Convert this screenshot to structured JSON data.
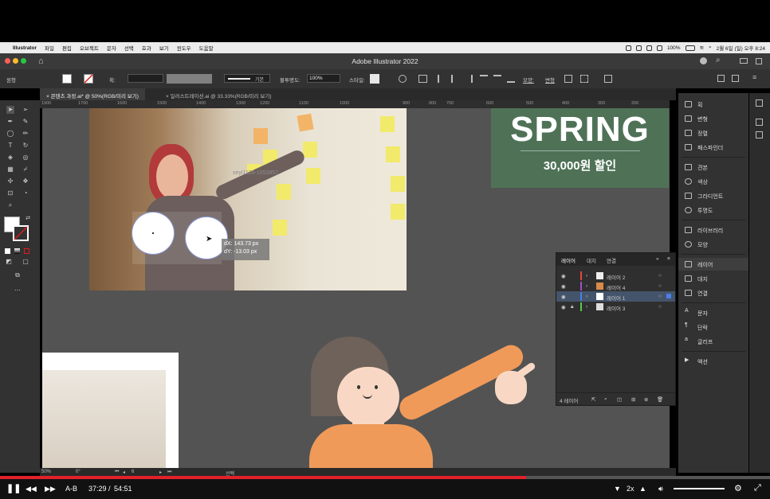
{
  "menubar": {
    "app": "Illustrator",
    "items": [
      "파일",
      "편집",
      "오브젝트",
      "문자",
      "선택",
      "효과",
      "보기",
      "윈도우",
      "도움말"
    ],
    "battery": "100%",
    "datetime": "2월 6일 (일) 오후 8:24"
  },
  "window": {
    "title": "Adobe Illustrator 2022"
  },
  "control": {
    "label": "원형",
    "stroke_label": "획:",
    "stroke_style": "기본",
    "opacity_label": "불투명도:",
    "opacity_value": "100%",
    "style_label": "스타일:",
    "shape_label": "모양:",
    "transform_label": "변형"
  },
  "tabs": [
    {
      "label": "콘텐츠 과정.ai* @ 50%(RGB/미리 보기)",
      "active": true
    },
    {
      "label": "일러스트레이션.ai @ 33.33%(RGB/미리 보기)",
      "active": false
    }
  ],
  "ruler": [
    "1900",
    "1700",
    "1600",
    "1500",
    "1400",
    "1300",
    "1200",
    "1100",
    "1000",
    "900",
    "800",
    "700",
    "600",
    "500",
    "400",
    "300",
    "200"
  ],
  "canvas": {
    "watermark": "seyi1128-1052857",
    "tooltip_dx": "dX: 143.73 px",
    "tooltip_dy": "dY: -13.03 px",
    "spring_title": "SPRING",
    "spring_sub": "30,000원 할인"
  },
  "layers_panel": {
    "tabs": [
      "레이어",
      "대지",
      "연결"
    ],
    "rows": [
      {
        "name": "레이어 2",
        "color": "#e8453c",
        "selected": false
      },
      {
        "name": "레이어 4",
        "color": "#a24fc8",
        "selected": false
      },
      {
        "name": "레이어 1",
        "color": "#4a7fe8",
        "selected": true
      },
      {
        "name": "레이어 3",
        "color": "#4bd04b",
        "selected": false
      }
    ],
    "footer": "4 레이어"
  },
  "right_panel": {
    "items": [
      "획",
      "변형",
      "정렬",
      "패스파인더",
      "견본",
      "색상",
      "그라디언트",
      "투명도",
      "라이브러리",
      "모양",
      "레이어",
      "대지",
      "연결",
      "문자",
      "단락",
      "글리프",
      "액션"
    ]
  },
  "status": {
    "zoom": "50%",
    "angle": "0°",
    "artboard": "6",
    "mode": "선택"
  },
  "player": {
    "ab": "A-B",
    "current": "37:29",
    "separator": "/",
    "total": "54:51",
    "speed": "2x",
    "progress": 0.683
  },
  "colors": {
    "spring_bg": "#4f7257",
    "progress": "#e3212b",
    "layer_selected": "#44546a"
  }
}
